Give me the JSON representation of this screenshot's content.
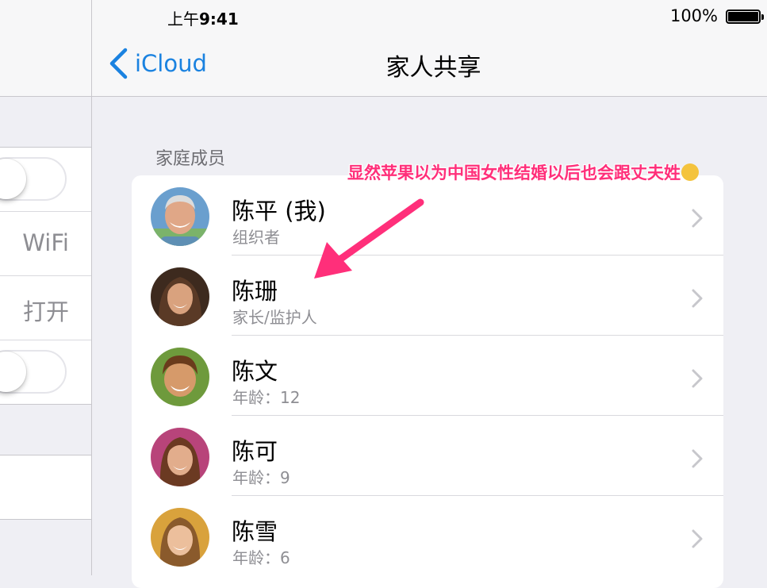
{
  "status_bar": {
    "time_prefix": "上午",
    "time": "9:41",
    "battery": "100%"
  },
  "left_pane": {
    "row_wifi": "WiFi",
    "row_open": "打开"
  },
  "nav": {
    "back_label": "iCloud",
    "title": "家人共享"
  },
  "section": {
    "header": "家庭成员"
  },
  "members": [
    {
      "name": "陈平 (我)",
      "role": "组织者",
      "avatar": "adult-man"
    },
    {
      "name": "陈珊",
      "role": "家长/监护人",
      "avatar": "adult-woman"
    },
    {
      "name": "陈文",
      "role": "年龄：12",
      "avatar": "boy"
    },
    {
      "name": "陈可",
      "role": "年龄：9",
      "avatar": "girl"
    },
    {
      "name": "陈雪",
      "role": "年龄：6",
      "avatar": "young-girl"
    }
  ],
  "annotation": {
    "text": "显然苹果以为中国女性结婚以后也会跟丈夫姓",
    "color": "#ff2f7a"
  },
  "colors": {
    "accent": "#1a82e0",
    "background": "#efeff4",
    "secondary_text": "#8e8e93"
  }
}
